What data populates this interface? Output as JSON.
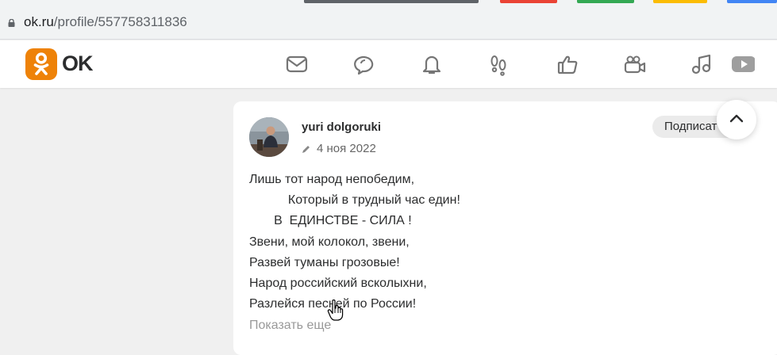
{
  "browser": {
    "tab_colors": [
      "#5f6368",
      "#ea4335",
      "#34a853",
      "#fbbc04",
      "#4285f4"
    ],
    "url_host": "ok.ru",
    "url_path": "/profile/557758311836"
  },
  "header": {
    "brand": "OK",
    "brand_color": "#ee8208",
    "nav_icons": [
      "mail-icon",
      "chat-icon",
      "bell-icon",
      "footprints-icon",
      "thumbs-up-icon",
      "video-camera-icon",
      "music-note-icon",
      "video-play-icon"
    ]
  },
  "post": {
    "author": "yuri dolgoruki",
    "date": "4 ноя 2022",
    "subscribe_label": "Подписат",
    "lines": [
      "Лишь тот народ непобедим,",
      "           Который в трудный час един!",
      "       В  ЕДИНСТВЕ - СИЛА !",
      "Звени, мой колокол, звени,",
      "Развей туманы грозовые!",
      "Народ российский всколыхни,",
      "Разлейся песней по России!"
    ],
    "show_more": "Показать еще"
  }
}
